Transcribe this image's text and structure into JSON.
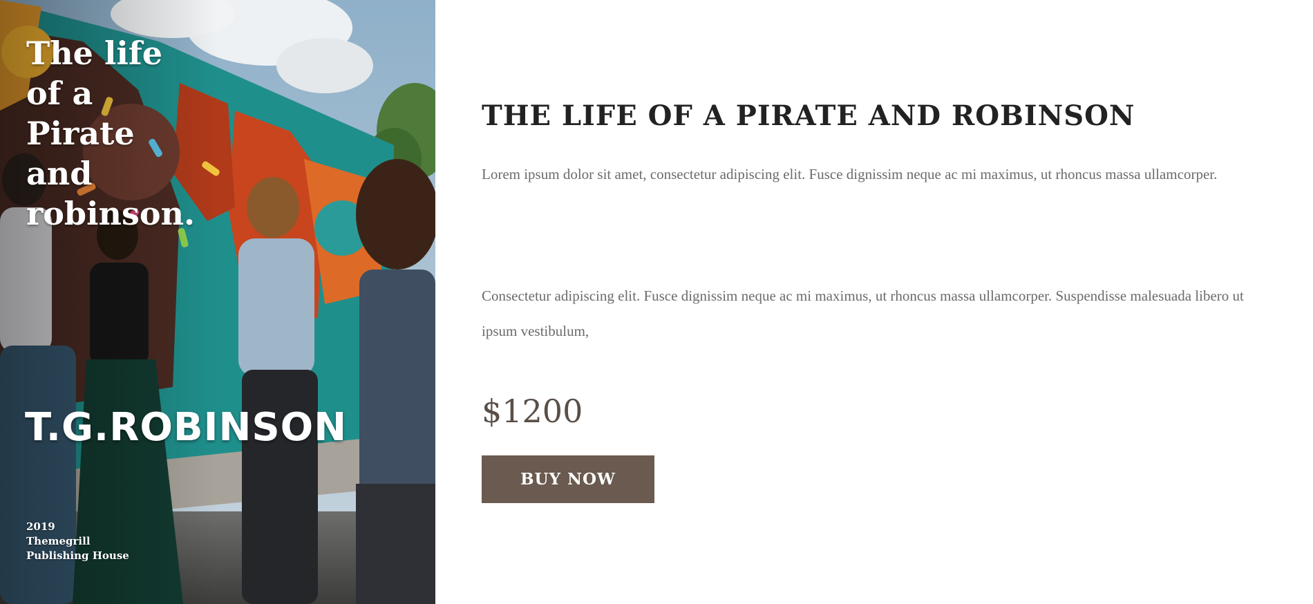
{
  "cover": {
    "title": "The life\nof a\nPirate\nand\nrobinson.",
    "author": "T.G.ROBINSON",
    "publisher_lines": [
      "2019",
      "Themegrill",
      "Publishing House"
    ]
  },
  "product": {
    "title": "The life of a pirate and robinson",
    "description_1": "Lorem ipsum dolor sit amet, consectetur adipiscing elit. Fusce dignissim neque ac mi maximus, ut rhoncus massa ullamcorper.",
    "description_2": "Consectetur adipiscing elit. Fusce dignissim neque ac mi maximus, ut rhoncus massa ullamcorper. Suspendisse malesuada libero ut ipsum vestibulum,",
    "price": "$1200",
    "buy_label": "Buy Now"
  },
  "colors": {
    "button_background": "#6a5a4f",
    "price_text": "#5a4f47",
    "title_text": "#222222",
    "body_text": "#6b6b6b"
  }
}
